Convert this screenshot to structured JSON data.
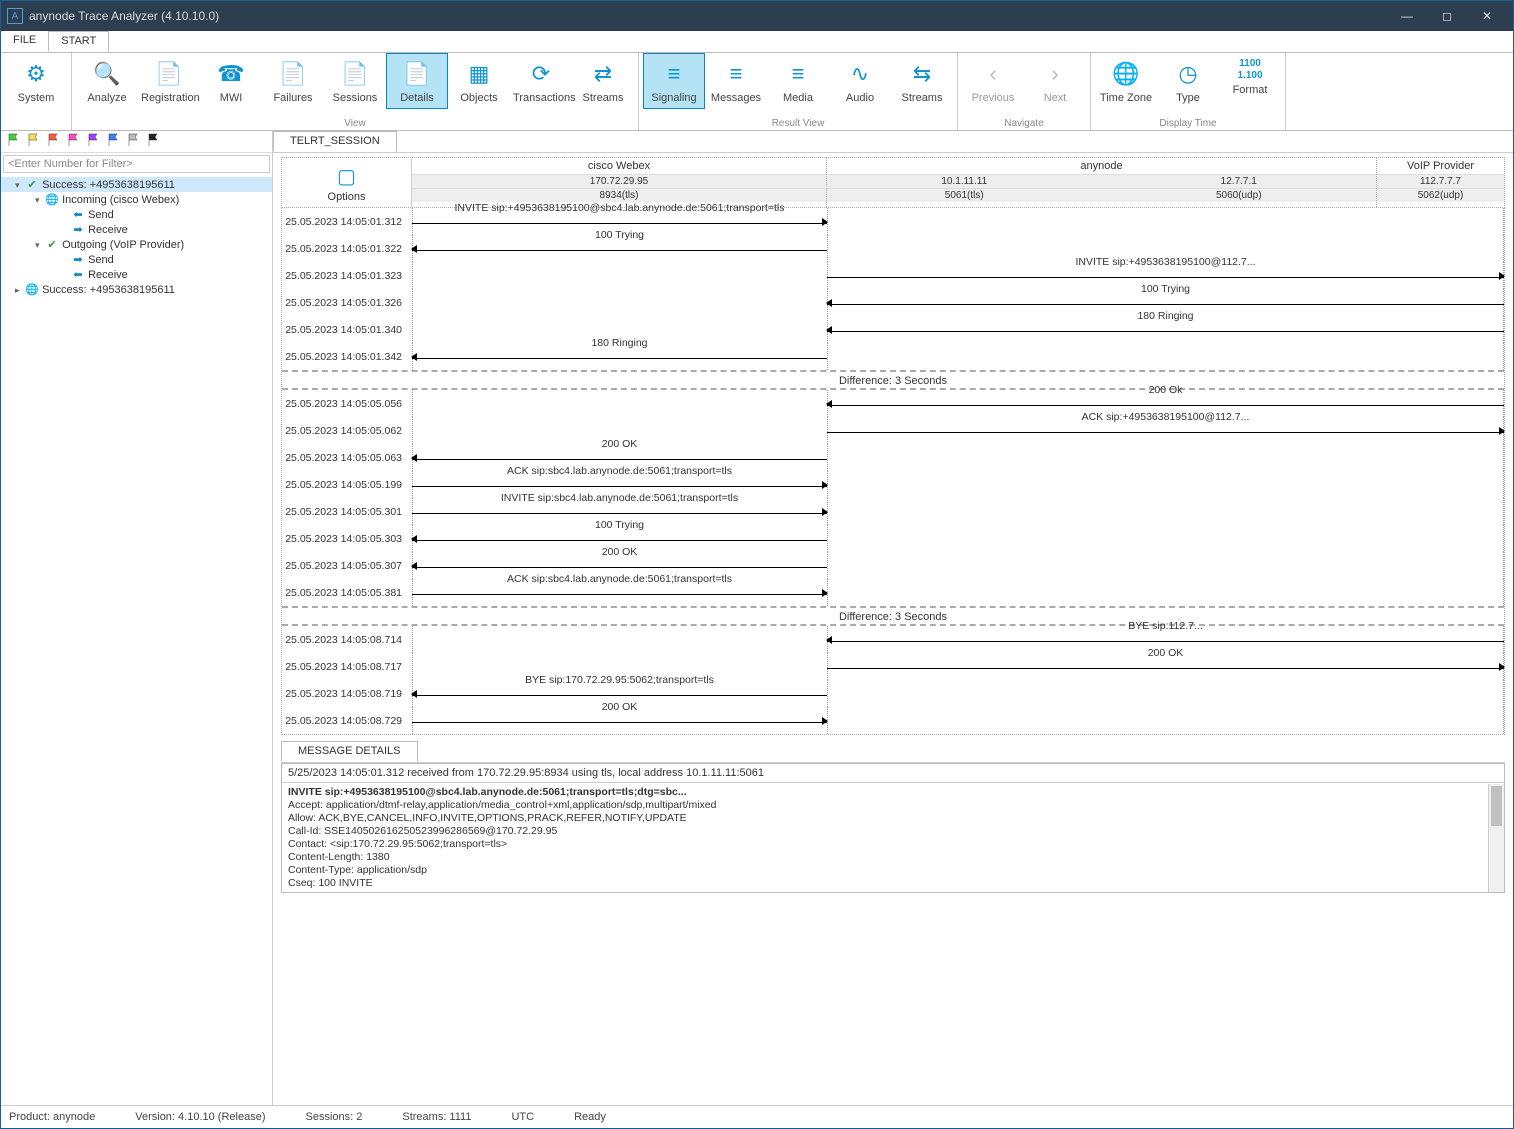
{
  "titlebar": {
    "text": "anynode Trace Analyzer (4.10.10.0)"
  },
  "menu": {
    "file": "FILE",
    "start": "START"
  },
  "ribbon": {
    "groups": [
      {
        "label": "",
        "items": [
          {
            "id": "system",
            "label": "System",
            "icon": "⚙"
          }
        ]
      },
      {
        "label": "View",
        "items": [
          {
            "id": "analyze",
            "label": "Analyze",
            "icon": "🔍"
          },
          {
            "id": "registration",
            "label": "Registration",
            "icon": "📄"
          },
          {
            "id": "mwi",
            "label": "MWI",
            "icon": "☎"
          },
          {
            "id": "failures",
            "label": "Failures",
            "icon": "📄"
          },
          {
            "id": "sessions",
            "label": "Sessions",
            "icon": "📄"
          },
          {
            "id": "details",
            "label": "Details",
            "icon": "📄",
            "active": true
          },
          {
            "id": "objects",
            "label": "Objects",
            "icon": "▦"
          },
          {
            "id": "transactions",
            "label": "Transactions",
            "icon": "⟳"
          },
          {
            "id": "streams",
            "label": "Streams",
            "icon": "⇄"
          }
        ]
      },
      {
        "label": "Result View",
        "items": [
          {
            "id": "signaling",
            "label": "Signaling",
            "icon": "≡",
            "active": true
          },
          {
            "id": "messages",
            "label": "Messages",
            "icon": "≡"
          },
          {
            "id": "media",
            "label": "Media",
            "icon": "≡"
          },
          {
            "id": "audio",
            "label": "Audio",
            "icon": "∿"
          },
          {
            "id": "rstreams",
            "label": "Streams",
            "icon": "⇆"
          }
        ]
      },
      {
        "label": "Navigate",
        "items": [
          {
            "id": "prev",
            "label": "Previous",
            "icon": "‹",
            "gray": true
          },
          {
            "id": "next",
            "label": "Next",
            "icon": "›",
            "gray": true
          }
        ]
      },
      {
        "label": "Display Time",
        "items": [
          {
            "id": "tz",
            "label": "Time Zone",
            "icon": "🌐"
          },
          {
            "id": "type",
            "label": "Type",
            "icon": "◷"
          },
          {
            "id": "format",
            "label": "Format",
            "dual": [
              "1100",
              "1.100"
            ]
          }
        ]
      }
    ]
  },
  "sidebar": {
    "filter_placeholder": "<Enter Number for Filter>",
    "flags": [
      "#3fd23f",
      "#ffe24b",
      "#ff5b3f",
      "#ff48c8",
      "#9e3fff",
      "#3f7bff",
      "#bbbbbb",
      "#222"
    ],
    "tree": [
      {
        "level": 0,
        "caret": "▾",
        "icon": "✔",
        "iconClass": "success-icon",
        "label": "Success: +4953638195611",
        "selected": true
      },
      {
        "level": 1,
        "caret": "▾",
        "icon": "🌐",
        "iconClass": "world-icon",
        "label": "Incoming (cisco Webex)"
      },
      {
        "level": 2,
        "caret": "",
        "icon": "⬅",
        "iconClass": "arrow-left",
        "label": "Send"
      },
      {
        "level": 2,
        "caret": "",
        "icon": "➡",
        "iconClass": "arrow-right",
        "label": "Receive"
      },
      {
        "level": 1,
        "caret": "▾",
        "icon": "✔",
        "iconClass": "success-icon",
        "label": "Outgoing (VoIP Provider)"
      },
      {
        "level": 2,
        "caret": "",
        "icon": "➡",
        "iconClass": "arrow-right",
        "label": "Send"
      },
      {
        "level": 2,
        "caret": "",
        "icon": "⬅",
        "iconClass": "arrow-left",
        "label": "Receive"
      },
      {
        "level": 0,
        "caret": "▸",
        "icon": "🌐",
        "iconClass": "world-icon",
        "label": "Success: +4953638195611"
      }
    ]
  },
  "session_tab": "TELRT_SESSION",
  "options_label": "Options",
  "columns": {
    "a": {
      "title": "cisco Webex",
      "sub1": "170.72.29.95",
      "sub2": "8934(tls)"
    },
    "b": {
      "title": "anynode",
      "subL1": "10.1.11.11",
      "subL2": "5061(tls)",
      "subR1": "12.7.7.1",
      "subR2": "5060(udp)"
    },
    "c": {
      "title": "VoIP Provider",
      "sub1": "112.7.7.7",
      "sub2": "5062(udp)"
    }
  },
  "messages": [
    {
      "ts": "25.05.2023 14:05:01.312",
      "lane": "left",
      "dir": "r",
      "label": "INVITE sip:+4953638195100@sbc4.lab.anynode.de:5061;transport=tls"
    },
    {
      "ts": "25.05.2023 14:05:01.322",
      "lane": "left",
      "dir": "l",
      "label": "100 Trying"
    },
    {
      "ts": "25.05.2023 14:05:01.323",
      "lane": "right",
      "dir": "r",
      "label": "INVITE sip:+4953638195100@112.7..."
    },
    {
      "ts": "25.05.2023 14:05:01.326",
      "lane": "right",
      "dir": "l",
      "label": "100 Trying"
    },
    {
      "ts": "25.05.2023 14:05:01.340",
      "lane": "right",
      "dir": "l",
      "label": "180 Ringing"
    },
    {
      "ts": "25.05.2023 14:05:01.342",
      "lane": "left",
      "dir": "l",
      "label": "180 Ringing"
    },
    {
      "gap": "Difference: 3 Seconds"
    },
    {
      "ts": "25.05.2023 14:05:05.056",
      "lane": "right",
      "dir": "l",
      "label": "200 Ok"
    },
    {
      "ts": "25.05.2023 14:05:05.062",
      "lane": "right",
      "dir": "r",
      "label": "ACK sip:+4953638195100@112.7..."
    },
    {
      "ts": "25.05.2023 14:05:05.063",
      "lane": "left",
      "dir": "l",
      "label": "200 OK"
    },
    {
      "ts": "25.05.2023 14:05:05.199",
      "lane": "left",
      "dir": "r",
      "label": "ACK sip:sbc4.lab.anynode.de:5061;transport=tls"
    },
    {
      "ts": "25.05.2023 14:05:05.301",
      "lane": "left",
      "dir": "r",
      "label": "INVITE sip:sbc4.lab.anynode.de:5061;transport=tls"
    },
    {
      "ts": "25.05.2023 14:05:05.303",
      "lane": "left",
      "dir": "l",
      "label": "100 Trying"
    },
    {
      "ts": "25.05.2023 14:05:05.307",
      "lane": "left",
      "dir": "l",
      "label": "200 OK"
    },
    {
      "ts": "25.05.2023 14:05:05.381",
      "lane": "left",
      "dir": "r",
      "label": "ACK sip:sbc4.lab.anynode.de:5061;transport=tls"
    },
    {
      "gap": "Difference: 3 Seconds"
    },
    {
      "ts": "25.05.2023 14:05:08.714",
      "lane": "right",
      "dir": "l",
      "label": "BYE sip:112.7..."
    },
    {
      "ts": "25.05.2023 14:05:08.717",
      "lane": "right",
      "dir": "r",
      "label": "200 OK"
    },
    {
      "ts": "25.05.2023 14:05:08.719",
      "lane": "left",
      "dir": "l",
      "label": "BYE sip:170.72.29.95:5062;transport=tls"
    },
    {
      "ts": "25.05.2023 14:05:08.729",
      "lane": "left",
      "dir": "r",
      "label": "200 OK"
    }
  ],
  "details": {
    "tab": "MESSAGE DETAILS",
    "subheader": "5/25/2023 14:05:01.312 received from 170.72.29.95:8934 using tls, local address 10.1.11.11:5061",
    "lines": [
      "INVITE sip:+4953638195100@sbc4.lab.anynode.de:5061;transport=tls;dtg=sbc...",
      "Accept: application/dtmf-relay,application/media_control+xml,application/sdp,multipart/mixed",
      "Allow: ACK,BYE,CANCEL,INFO,INVITE,OPTIONS,PRACK,REFER,NOTIFY,UPDATE",
      "Call-Id: SSE140502616250523996286569@170.72.29.95",
      "Contact: <sip:170.72.29.95:5062;transport=tls>",
      "Content-Length: 1380",
      "Content-Type: application/sdp",
      "Cseq: 100 INVITE"
    ]
  },
  "statusbar": {
    "product": "Product: anynode",
    "version": "Version: 4.10.10 (Release)",
    "sessions": "Sessions: 2",
    "streams": "Streams: 1111",
    "utc": "UTC",
    "ready": "Ready"
  }
}
